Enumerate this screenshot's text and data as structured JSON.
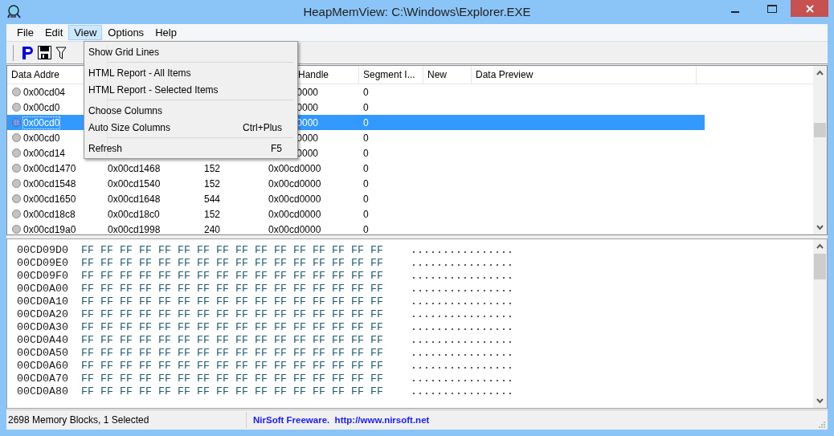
{
  "window": {
    "title": "HeapMemView:  C:\\Windows\\Explorer.EXE"
  },
  "menu_bar": [
    {
      "label": "File",
      "selected": false
    },
    {
      "label": "Edit",
      "selected": false
    },
    {
      "label": "View",
      "selected": true
    },
    {
      "label": "Options",
      "selected": false
    },
    {
      "label": "Help",
      "selected": false
    }
  ],
  "view_menu": [
    {
      "kind": "item",
      "label": "Show Grid Lines"
    },
    {
      "kind": "separator"
    },
    {
      "kind": "item",
      "label": "HTML Report - All Items"
    },
    {
      "kind": "item",
      "label": "HTML Report - Selected Items"
    },
    {
      "kind": "separator"
    },
    {
      "kind": "item",
      "label": "Choose Columns"
    },
    {
      "kind": "item",
      "label": "Auto Size Columns",
      "shortcut": "Ctrl+Plus"
    },
    {
      "kind": "separator"
    },
    {
      "kind": "item",
      "label": "Refresh",
      "shortcut": "F5"
    }
  ],
  "table": {
    "columns": [
      {
        "label": "Data Addre"
      },
      {},
      {},
      {
        "label": "Handle"
      },
      {
        "label": "Segment I..."
      },
      {
        "label": "New"
      },
      {
        "label": "Data Preview"
      }
    ],
    "rows": [
      {
        "address": "0x00cd04",
        "handle": "0000",
        "segment": "0",
        "selected": false
      },
      {
        "address": "0x00cd0",
        "handle": "0000",
        "segment": "0",
        "selected": false
      },
      {
        "address": "0x00cd0",
        "handle": "0000",
        "segment": "0",
        "selected": true
      },
      {
        "address": "0x00cd0",
        "handle": "0000",
        "segment": "0",
        "selected": false
      },
      {
        "address": "0x00cd14",
        "handle": "0000",
        "segment": "0",
        "selected": false
      },
      {
        "address": "0x00cd1470",
        "column_2": "0x00cd1468",
        "column_3": "152",
        "handle": "0x00cd0000",
        "segment": "0",
        "selected": false
      },
      {
        "address": "0x00cd1548",
        "column_2": "0x00cd1540",
        "column_3": "152",
        "handle": "0x00cd0000",
        "segment": "0",
        "selected": false
      },
      {
        "address": "0x00cd1650",
        "column_2": "0x00cd1648",
        "column_3": "544",
        "handle": "0x00cd0000",
        "segment": "0",
        "selected": false
      },
      {
        "address": "0x00cd18c8",
        "column_2": "0x00cd18c0",
        "column_3": "152",
        "handle": "0x00cd0000",
        "segment": "0",
        "selected": false
      },
      {
        "address": "0x00cd19a0",
        "column_2": "0x00cd1998",
        "column_3": "240",
        "handle": "0x00cd0000",
        "segment": "0",
        "selected": false
      }
    ]
  },
  "hex_dump": [
    {
      "address": "00CD09D0",
      "bytes": "FF FF FF FF FF FF FF FF FF FF FF FF FF FF FF FF",
      "ascii": "................"
    },
    {
      "address": "00CD09E0",
      "bytes": "FF FF FF FF FF FF FF FF FF FF FF FF FF FF FF FF",
      "ascii": "................"
    },
    {
      "address": "00CD09F0",
      "bytes": "FF FF FF FF FF FF FF FF FF FF FF FF FF FF FF FF",
      "ascii": "................"
    },
    {
      "address": "00CD0A00",
      "bytes": "FF FF FF FF FF FF FF FF FF FF FF FF FF FF FF FF",
      "ascii": "................"
    },
    {
      "address": "00CD0A10",
      "bytes": "FF FF FF FF FF FF FF FF FF FF FF FF FF FF FF FF",
      "ascii": "................"
    },
    {
      "address": "00CD0A20",
      "bytes": "FF FF FF FF FF FF FF FF FF FF FF FF FF FF FF FF",
      "ascii": "................"
    },
    {
      "address": "00CD0A30",
      "bytes": "FF FF FF FF FF FF FF FF FF FF FF FF FF FF FF FF",
      "ascii": "................"
    },
    {
      "address": "00CD0A40",
      "bytes": "FF FF FF FF FF FF FF FF FF FF FF FF FF FF FF FF",
      "ascii": "................"
    },
    {
      "address": "00CD0A50",
      "bytes": "FF FF FF FF FF FF FF FF FF FF FF FF FF FF FF FF",
      "ascii": "................"
    },
    {
      "address": "00CD0A60",
      "bytes": "FF FF FF FF FF FF FF FF FF FF FF FF FF FF FF FF",
      "ascii": "................"
    },
    {
      "address": "00CD0A70",
      "bytes": "FF FF FF FF FF FF FF FF FF FF FF FF FF FF FF FF",
      "ascii": "................"
    },
    {
      "address": "00CD0A80",
      "bytes": "FF FF FF FF FF FF FF FF FF FF FF FF FF FF FF FF",
      "ascii": "................"
    }
  ],
  "status_bar": {
    "summary": "2698 Memory Blocks, 1 Selected",
    "credit": "NirSoft Freeware.  http://www.nirsoft.net"
  }
}
